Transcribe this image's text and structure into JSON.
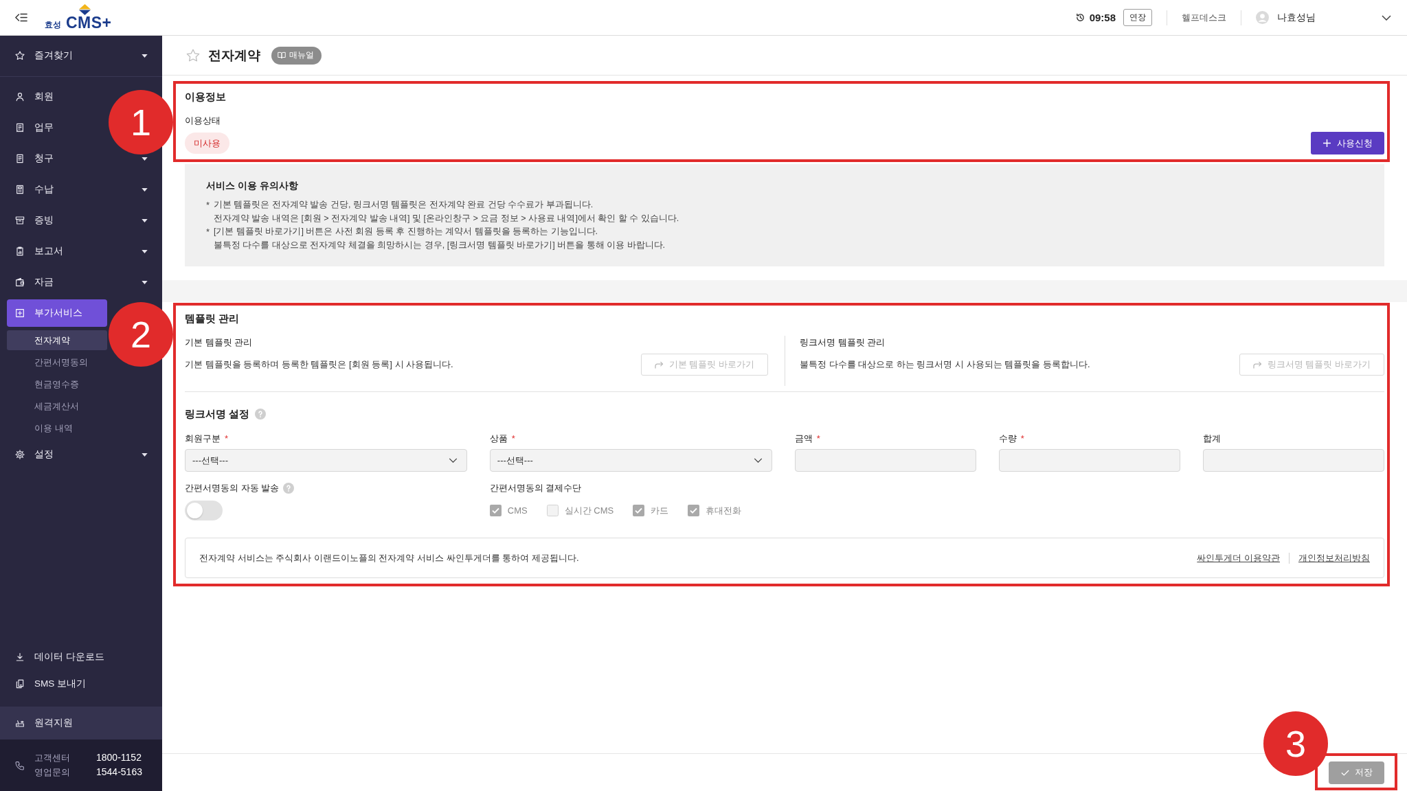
{
  "topbar": {
    "logo_small": "효성",
    "logo": "CMS+",
    "session_time": "09:58",
    "extend_button": "연장",
    "helpdesk_link": "헬프데스크",
    "user_name": "나효성님"
  },
  "sidebar": {
    "favorites": {
      "label": "즐겨찾기",
      "caret": true
    },
    "items": [
      {
        "label": "회원",
        "caret": false,
        "selected": false
      },
      {
        "label": "업무",
        "caret": false,
        "selected": false
      },
      {
        "label": "청구",
        "caret": true,
        "selected": false
      },
      {
        "label": "수납",
        "caret": true,
        "selected": false
      },
      {
        "label": "증빙",
        "caret": true,
        "selected": false
      },
      {
        "label": "보고서",
        "caret": true,
        "selected": false
      },
      {
        "label": "자금",
        "caret": true,
        "selected": false
      },
      {
        "label": "부가서비스",
        "caret": false,
        "selected": true,
        "expanded": true,
        "children": [
          {
            "label": "전자계약",
            "selected": true
          },
          {
            "label": "간편서명동의",
            "selected": false
          },
          {
            "label": "현금영수증",
            "selected": false
          },
          {
            "label": "세금계산서",
            "selected": false
          },
          {
            "label": "이용 내역",
            "selected": false
          }
        ]
      },
      {
        "label": "설정",
        "caret": true,
        "selected": false
      }
    ],
    "bottom_items": [
      {
        "label": "데이터 다운로드"
      },
      {
        "label": "SMS 보내기"
      }
    ],
    "remote_support": {
      "label": "원격지원"
    },
    "contacts": [
      {
        "label": "고객센터",
        "number": "1800-1152"
      },
      {
        "label": "영업문의",
        "number": "1544-5163"
      }
    ]
  },
  "page": {
    "title": "전자계약",
    "favorite": false,
    "manual_button": "매뉴얼"
  },
  "usage_info": {
    "callout": "1",
    "title": "이용정보",
    "status_label": "이용상태",
    "status": "미사용",
    "apply_button": "사용신청"
  },
  "notice": {
    "title": "서비스 이용 유의사항",
    "items": [
      {
        "marker": "*",
        "lines": [
          "기본 템플릿은 전자계약 발송 건당, 링크서명 템플릿은 전자계약 완료 건당 수수료가 부과됩니다.",
          "전자계약 발송 내역은 [회원 > 전자계약 발송 내역] 및 [온라인창구 > 요금 정보 > 사용료 내역]에서 확인 할 수 있습니다."
        ]
      },
      {
        "marker": "*",
        "lines": [
          "[기본 템플릿 바로가기] 버튼은 사전 회원 등록 후 진행하는 계약서 템플릿을 등록하는 기능입니다.",
          "불특정 다수를 대상으로 전자계약 체결을 희망하시는 경우, [링크서명 템플릿 바로가기] 버튼을 통해 이용 바랍니다."
        ]
      }
    ]
  },
  "template_management": {
    "callout": "2",
    "title": "템플릿 관리",
    "columns": [
      {
        "title": "기본 템플릿 관리",
        "description": "기본 템플릿을 등록하며 등록한 템플릿은 [회원 등록] 시 사용됩니다.",
        "button": "기본 템플릿 바로가기",
        "disabled": true
      },
      {
        "title": "링크서명 템플릿 관리",
        "description": "불특정 다수를 대상으로 하는 링크서명 시 사용되는 템플릿을 등록합니다.",
        "button": "링크서명 템플릿 바로가기",
        "disabled": true
      }
    ]
  },
  "link_sign": {
    "title": "링크서명 설정",
    "fields": [
      {
        "kind": "select",
        "label": "회원구분",
        "required_mark": "*",
        "value": "---선택---"
      },
      {
        "kind": "select",
        "label": "상품",
        "required_mark": "*",
        "value": "---선택---"
      },
      {
        "kind": "text",
        "label": "금액",
        "required_mark": "*"
      },
      {
        "kind": "text",
        "label": "수량",
        "required_mark": "*"
      },
      {
        "kind": "text",
        "label": "합계"
      }
    ],
    "auto_send": {
      "label": "간편서명동의 자동 발송",
      "on": false
    },
    "payment_methods": {
      "label": "간편서명동의 결제수단",
      "options": [
        {
          "label": "CMS",
          "checked": true,
          "disabled": true
        },
        {
          "label": "실시간 CMS",
          "checked": false,
          "disabled": true
        },
        {
          "label": "카드",
          "checked": true,
          "disabled": true
        },
        {
          "label": "휴대전화",
          "checked": true,
          "disabled": true
        }
      ]
    }
  },
  "provider_note": {
    "text": "전자계약 서비스는 주식회사 이랜드이노플의 전자계약 서비스 싸인투게더를 통하여 제공됩니다.",
    "links": [
      "싸인투게더 이용약관",
      "개인정보처리방침"
    ]
  },
  "footer": {
    "callout": "3",
    "save_button": "저장",
    "save_disabled": true
  }
}
